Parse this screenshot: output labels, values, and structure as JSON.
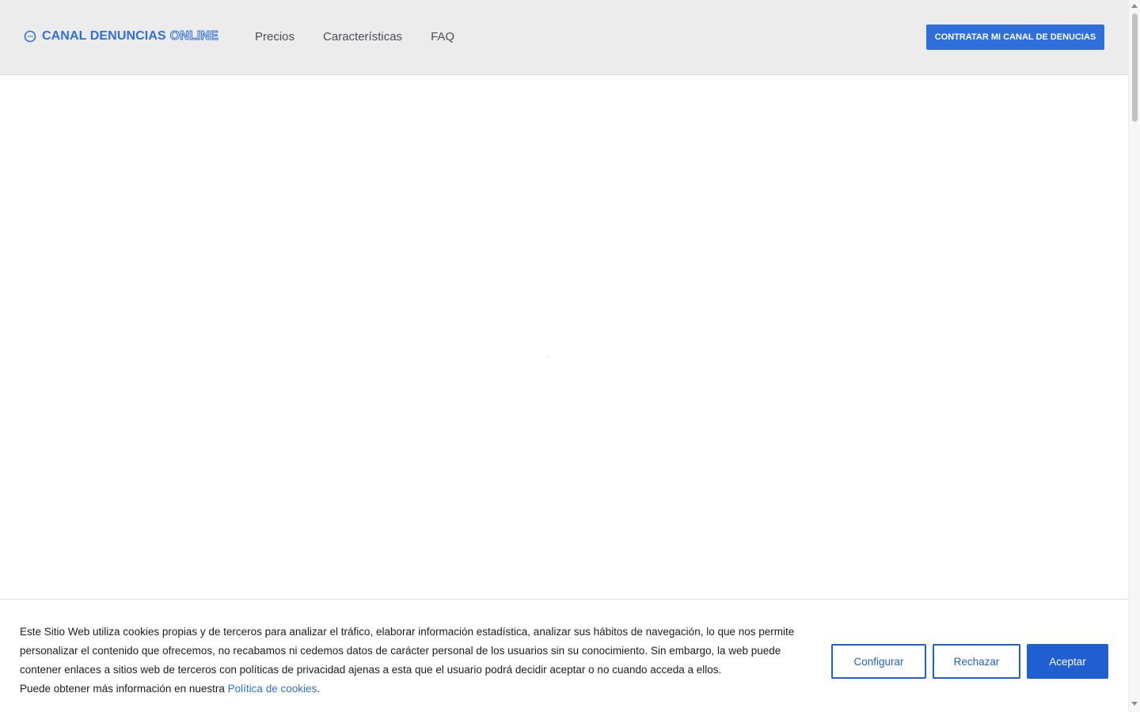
{
  "header": {
    "logo_main": "CANAL DENUNCIAS",
    "logo_accent": "ONLINE",
    "nav": [
      "Precios",
      "Características",
      "FAQ"
    ],
    "cta_label": "CONTRATAR MI CANAL DE DENUCIAS"
  },
  "cookie_banner": {
    "text_line1": "Este Sitio Web utiliza cookies propias y de terceros para analizar el tráfico, elaborar información estadística, analizar sus hábitos de navegación, lo que nos permite personalizar el contenido que ofrecemos, no recabamos ni cedemos datos de carácter personal de los usuarios sin su conocimiento. Sin embargo, la web puede contener enlaces a sitios web de terceros con políticas de privacidad ajenas a esta que el usuario podrá decidir aceptar o no cuando acceda a ellos.",
    "text_line2_prefix": "Puede obtener más información en nuestra",
    "link_label": "Política de cookies",
    "text_line2_suffix": ".",
    "buttons": {
      "configure": "Configurar",
      "reject": "Rechazar",
      "accept": "Aceptar"
    }
  },
  "colors": {
    "brand": "#2f6fdb",
    "button": "#1f5fcf",
    "header_bg": "#ececec"
  }
}
